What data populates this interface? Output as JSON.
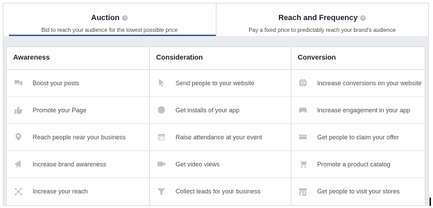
{
  "tabs": [
    {
      "title": "Auction",
      "subtitle": "Bid to reach your audience for the lowest possible price",
      "active": true
    },
    {
      "title": "Reach and Frequency",
      "subtitle": "Pay a fixed price to predictably reach your brand's audience",
      "active": false
    }
  ],
  "columns": [
    {
      "heading": "Awareness",
      "items": [
        {
          "label": "Boost your posts",
          "icon": "speech-bubbles-icon"
        },
        {
          "label": "Promote your Page",
          "icon": "thumbs-up-icon"
        },
        {
          "label": "Reach people near your business",
          "icon": "map-pin-icon"
        },
        {
          "label": "Increase brand awareness",
          "icon": "megaphone-icon"
        },
        {
          "label": "Increase your reach",
          "icon": "snowflake-icon"
        }
      ]
    },
    {
      "heading": "Consideration",
      "items": [
        {
          "label": "Send people to your website",
          "icon": "cursor-arrow-icon"
        },
        {
          "label": "Get installs of your app",
          "icon": "cube-icon"
        },
        {
          "label": "Raise attendance at your event",
          "icon": "calendar-icon"
        },
        {
          "label": "Get video views",
          "icon": "video-camera-icon"
        },
        {
          "label": "Collect leads for your business",
          "icon": "funnel-icon"
        }
      ]
    },
    {
      "heading": "Conversion",
      "items": [
        {
          "label": "Increase conversions on your website",
          "icon": "globe-icon"
        },
        {
          "label": "Increase engagement in your app",
          "icon": "gamepad-icon"
        },
        {
          "label": "Get people to claim your offer",
          "icon": "ticket-icon"
        },
        {
          "label": "Promote a product catalog",
          "icon": "shopping-cart-icon"
        },
        {
          "label": "Get people to visit your stores",
          "icon": "storefront-icon"
        }
      ]
    }
  ]
}
